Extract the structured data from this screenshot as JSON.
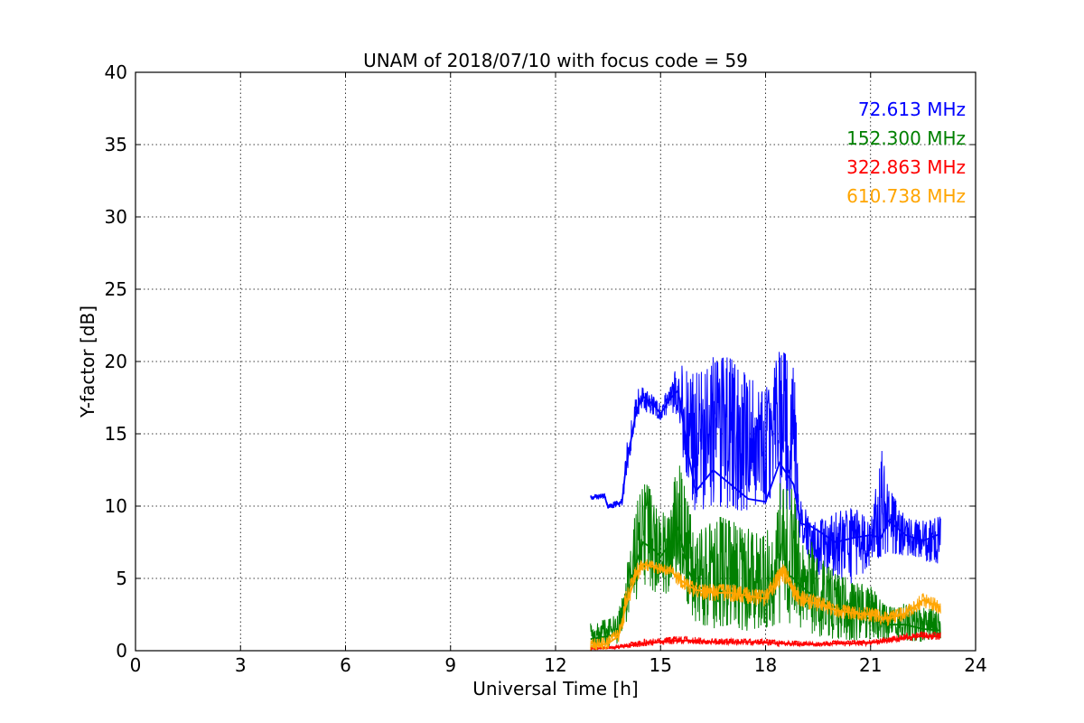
{
  "chart_data": {
    "type": "line",
    "title": "UNAM of 2018/07/10 with focus code = 59",
    "xlabel": "Universal Time [h]",
    "ylabel": "Y-factor [dB]",
    "xlim": [
      0,
      24
    ],
    "ylim": [
      0,
      40
    ],
    "xticks": [
      0,
      3,
      6,
      9,
      12,
      15,
      18,
      21,
      24
    ],
    "yticks": [
      0,
      5,
      10,
      15,
      20,
      25,
      30,
      35,
      40
    ],
    "grid": true,
    "legend_position": "top-right",
    "series": [
      {
        "name": "72.613 MHz",
        "color": "#0000ff",
        "x": [
          13.0,
          13.4,
          13.5,
          13.9,
          14.0,
          14.3,
          14.5,
          14.8,
          15.0,
          15.3,
          15.5,
          15.8,
          16.0,
          16.5,
          17.0,
          17.5,
          18.0,
          18.4,
          18.8,
          19.0,
          19.3,
          19.5,
          20.0,
          20.5,
          21.0,
          21.3,
          21.5,
          22.0,
          22.5,
          23.0
        ],
        "y": [
          10.6,
          10.7,
          9.9,
          10.3,
          12.5,
          16.5,
          17.6,
          17.0,
          16.4,
          17.5,
          18.0,
          13.5,
          11.0,
          12.5,
          11.5,
          10.5,
          10.3,
          13.0,
          11.5,
          8.8,
          8.6,
          8.3,
          7.5,
          7.8,
          8.0,
          7.8,
          9.0,
          8.0,
          7.6,
          8.1
        ],
        "y_upper": [
          10.8,
          10.9,
          10.1,
          10.6,
          13.8,
          18.0,
          18.3,
          17.6,
          17.2,
          18.5,
          20.0,
          19.5,
          19.2,
          20.3,
          20.4,
          19.0,
          18.0,
          20.8,
          20.2,
          10.5,
          9.0,
          9.0,
          9.6,
          10.0,
          8.9,
          14.2,
          11.4,
          9.2,
          9.0,
          9.3
        ],
        "y_lower": [
          10.4,
          10.5,
          9.7,
          10.0,
          11.5,
          15.9,
          16.5,
          16.3,
          15.8,
          16.6,
          16.0,
          10.5,
          9.5,
          10.0,
          9.8,
          9.6,
          9.8,
          9.8,
          9.5,
          7.5,
          6.0,
          5.0,
          5.0,
          4.5,
          6.0,
          6.5,
          6.8,
          6.5,
          6.2,
          6.0
        ]
      },
      {
        "name": "152.300 MHz",
        "color": "#008000",
        "x": [
          13.0,
          13.5,
          13.8,
          14.0,
          14.3,
          14.5,
          14.8,
          15.0,
          15.3,
          15.5,
          15.8,
          16.0,
          16.5,
          17.0,
          17.5,
          18.0,
          18.5,
          18.8,
          19.0,
          19.5,
          20.0,
          20.5,
          21.0,
          21.5,
          22.0,
          22.5,
          23.0
        ],
        "y": [
          0.8,
          1.0,
          1.2,
          3.5,
          6.0,
          7.5,
          7.0,
          6.5,
          7.5,
          8.5,
          5.5,
          4.5,
          4.0,
          4.2,
          3.5,
          3.8,
          5.5,
          5.0,
          4.5,
          3.5,
          3.0,
          2.5,
          2.2,
          1.8,
          1.8,
          1.5,
          1.4
        ],
        "y_upper": [
          2.0,
          2.2,
          2.6,
          5.5,
          10.0,
          11.8,
          11.0,
          9.5,
          11.0,
          13.5,
          10.0,
          8.0,
          9.5,
          9.0,
          8.5,
          8.0,
          12.8,
          11.0,
          8.5,
          7.0,
          5.5,
          4.8,
          4.5,
          3.0,
          3.4,
          3.0,
          2.8
        ],
        "y_lower": [
          0.2,
          0.3,
          0.5,
          1.8,
          3.5,
          4.5,
          4.0,
          3.8,
          4.0,
          4.8,
          3.0,
          2.0,
          1.5,
          1.8,
          1.2,
          1.5,
          2.0,
          1.8,
          1.5,
          1.0,
          0.8,
          0.7,
          0.8,
          0.8,
          0.7,
          0.6,
          0.6
        ]
      },
      {
        "name": "322.863 MHz",
        "color": "#ff0000",
        "x": [
          13.0,
          13.5,
          14.0,
          14.5,
          15.0,
          15.5,
          16.0,
          16.5,
          17.0,
          17.5,
          18.0,
          18.5,
          19.0,
          19.5,
          20.0,
          20.5,
          21.0,
          21.5,
          22.0,
          22.5,
          23.0
        ],
        "y": [
          0.15,
          0.2,
          0.3,
          0.5,
          0.6,
          0.7,
          0.7,
          0.6,
          0.6,
          0.6,
          0.55,
          0.5,
          0.45,
          0.45,
          0.5,
          0.5,
          0.55,
          0.7,
          0.9,
          1.0,
          1.0
        ],
        "y_upper": [
          0.25,
          0.3,
          0.5,
          0.8,
          0.9,
          1.0,
          0.95,
          0.85,
          0.85,
          0.85,
          0.8,
          0.7,
          0.65,
          0.65,
          0.7,
          0.7,
          0.75,
          0.95,
          1.2,
          1.3,
          1.3
        ],
        "y_lower": [
          0.05,
          0.1,
          0.15,
          0.3,
          0.4,
          0.45,
          0.45,
          0.4,
          0.4,
          0.4,
          0.35,
          0.3,
          0.3,
          0.3,
          0.3,
          0.3,
          0.35,
          0.5,
          0.65,
          0.75,
          0.75
        ]
      },
      {
        "name": "610.738 MHz",
        "color": "#ffa500",
        "x": [
          13.0,
          13.5,
          13.8,
          14.0,
          14.3,
          14.5,
          14.8,
          15.0,
          15.3,
          15.5,
          16.0,
          16.5,
          17.0,
          17.5,
          18.0,
          18.5,
          18.8,
          19.0,
          19.5,
          20.0,
          20.5,
          21.0,
          21.5,
          22.0,
          22.5,
          23.0
        ],
        "y": [
          0.3,
          0.5,
          1.0,
          3.0,
          5.2,
          6.0,
          5.8,
          5.6,
          5.5,
          5.0,
          4.2,
          4.0,
          4.0,
          3.8,
          3.6,
          5.5,
          4.0,
          3.6,
          3.2,
          2.8,
          2.6,
          2.5,
          2.2,
          2.6,
          3.5,
          3.0
        ],
        "y_upper": [
          0.8,
          1.0,
          1.6,
          4.2,
          6.0,
          6.4,
          6.2,
          6.0,
          5.9,
          5.5,
          4.8,
          4.6,
          4.6,
          4.4,
          4.2,
          6.2,
          4.8,
          4.2,
          3.8,
          3.3,
          3.1,
          3.0,
          2.7,
          3.1,
          4.0,
          3.5
        ],
        "y_lower": [
          0.0,
          0.1,
          0.6,
          2.2,
          4.6,
          5.6,
          5.4,
          5.2,
          5.0,
          4.5,
          3.6,
          3.4,
          3.4,
          3.2,
          3.0,
          4.8,
          3.4,
          3.0,
          2.7,
          2.3,
          2.1,
          2.0,
          1.7,
          2.1,
          3.0,
          2.5
        ]
      }
    ]
  }
}
